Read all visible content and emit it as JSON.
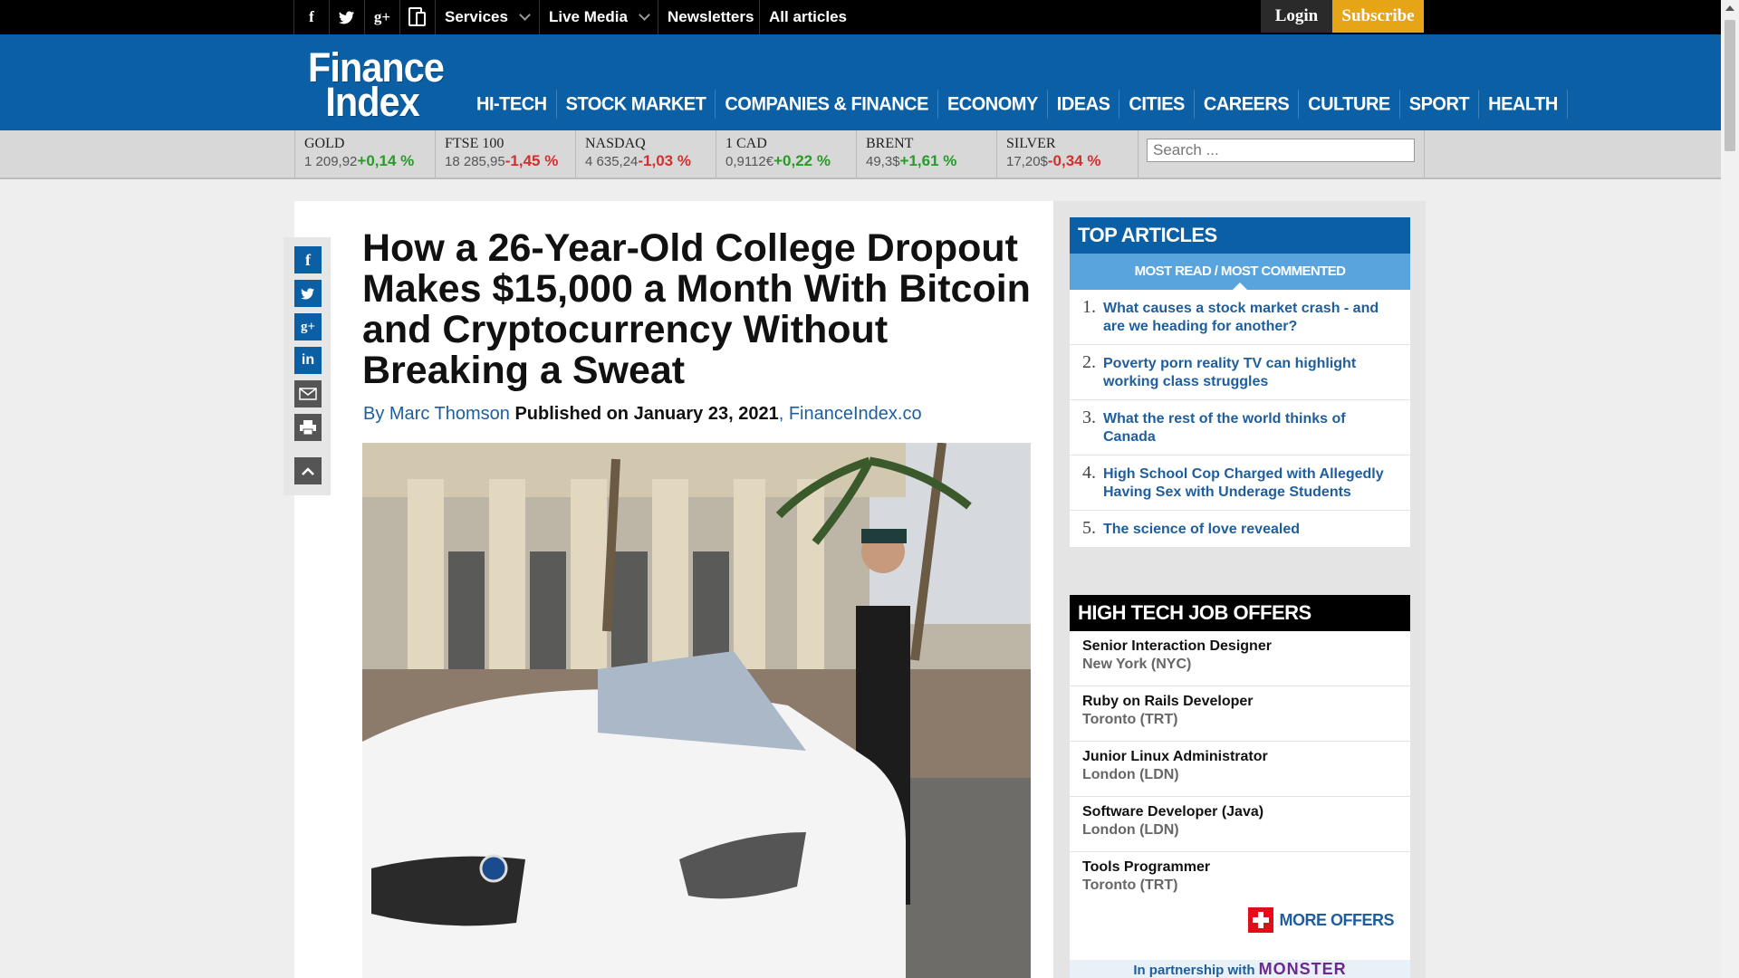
{
  "topbar": {
    "social": [
      "f",
      "t",
      "g+",
      "▭"
    ],
    "menu": [
      {
        "label": "Services",
        "has_dropdown": true
      },
      {
        "label": "Live Media",
        "has_dropdown": true
      },
      {
        "label": "Newsletters",
        "has_dropdown": false
      },
      {
        "label": "All articles",
        "has_dropdown": false
      }
    ],
    "login": "Login",
    "subscribe": "Subscribe"
  },
  "header": {
    "logo_line1": "Finance",
    "logo_line2": "Index",
    "nav": [
      "HI-TECH",
      "STOCK MARKET",
      "COMPANIES & FINANCE",
      "ECONOMY",
      "IDEAS",
      "CITIES",
      "CAREERS",
      "CULTURE",
      "SPORT",
      "HEALTH"
    ]
  },
  "ticker": [
    {
      "name": "GOLD",
      "value": "1 209,92",
      "change": "+0,14 %",
      "dir": "pos"
    },
    {
      "name": "FTSE 100",
      "value": "18 285,95",
      "change": "-1,45 %",
      "dir": "neg"
    },
    {
      "name": "NASDAQ",
      "value": "4 635,24",
      "change": "-1,03 %",
      "dir": "neg"
    },
    {
      "name": "1 CAD",
      "value": "0,9112€",
      "change": "+0,22 %",
      "dir": "pos"
    },
    {
      "name": "BRENT",
      "value": "49,3$",
      "change": "+1,61 %",
      "dir": "pos"
    },
    {
      "name": "SILVER",
      "value": "17,20$",
      "change": "-0,34 %",
      "dir": "neg"
    }
  ],
  "search": {
    "placeholder": "Search ..."
  },
  "article": {
    "title": "How a 26-Year-Old College Dropout Makes $15,000 a Month With Bitcoin and Cryptocurrency Without Breaking a Sweat",
    "by": "By Marc Thomson",
    "published": "Published on January 23, 2021",
    "source": ", FinanceIndex.co"
  },
  "share_icons": [
    "facebook-icon",
    "twitter-icon",
    "google-plus-icon",
    "linkedin-icon",
    "email-icon",
    "print-icon",
    "scroll-top-icon"
  ],
  "top_articles": {
    "heading": "TOP ARTICLES",
    "subheading": "MOST READ / MOST COMMENTED",
    "items": [
      {
        "num": "1.",
        "title": "What causes a stock market crash - and are we heading for another?"
      },
      {
        "num": "2.",
        "title": "Poverty porn reality TV can highlight working class struggles"
      },
      {
        "num": "3.",
        "title": "What the rest of the world thinks of Canada"
      },
      {
        "num": "4.",
        "title": "High School Cop Charged with Allegedly Having Sex with Underage Students"
      },
      {
        "num": "5.",
        "title": "The science of love revealed"
      }
    ]
  },
  "jobs": {
    "heading": "HIGH TECH JOB OFFERS",
    "items": [
      {
        "title": "Senior Interaction Designer",
        "location": "New York  (NYC)"
      },
      {
        "title": "Ruby on Rails Developer",
        "location": "Toronto  (TRT)"
      },
      {
        "title": "Junior Linux Administrator",
        "location": "London  (LDN)"
      },
      {
        "title": "Software Developer (Java)",
        "location": "London  (LDN)"
      },
      {
        "title": "Tools Programmer",
        "location": "Toronto  (TRT)"
      }
    ],
    "more": "MORE OFFERS",
    "partner_text": "In partnership with",
    "partner_name": "MONSTER"
  },
  "colors": {
    "brand_blue": "#0b5fa5",
    "light_blue": "#5aa4dd",
    "subscribe": "#e6a417",
    "positive": "#2a9a2a",
    "negative": "#d23030"
  }
}
